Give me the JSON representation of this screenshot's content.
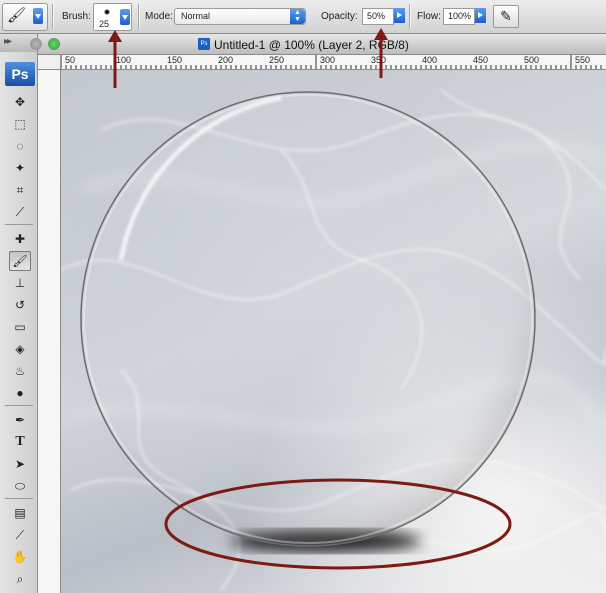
{
  "options_bar": {
    "brush_label": "Brush:",
    "brush_size": "25",
    "mode_label": "Mode:",
    "mode_value": "Normal",
    "opacity_label": "Opacity:",
    "opacity_value": "50%",
    "flow_label": "Flow:",
    "flow_value": "100%"
  },
  "toolbox": {
    "logo": "Ps",
    "tools": [
      "move-tool",
      "marquee-tool",
      "lasso-tool",
      "magic-wand-tool",
      "crop-tool",
      "slice-tool",
      "healing-brush-tool",
      "brush-tool",
      "clone-stamp-tool",
      "history-brush-tool",
      "eraser-tool",
      "paint-bucket-tool",
      "blur-tool",
      "dodge-tool",
      "pen-tool",
      "type-tool",
      "path-selection-tool",
      "ellipse-tool",
      "notes-tool",
      "eyedropper-tool",
      "hand-tool",
      "zoom-tool"
    ],
    "type_glyph": "T"
  },
  "document": {
    "title": "Untitled-1 @ 100% (Layer 2, RGB/8)",
    "icon_text": "Ps",
    "ruler_labels": [
      "50",
      "100",
      "150",
      "200",
      "250",
      "300",
      "350",
      "400",
      "450",
      "500",
      "550"
    ]
  },
  "colors": {
    "annotation": "#7d1a12",
    "accent_blue": "#1d5fc8"
  }
}
